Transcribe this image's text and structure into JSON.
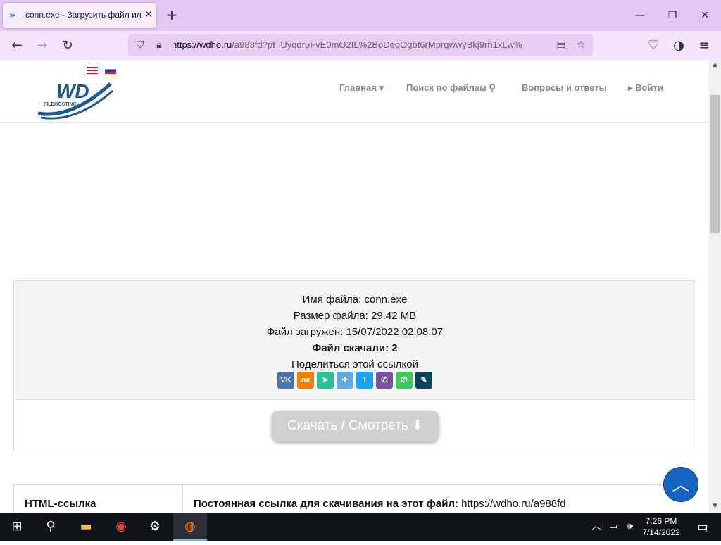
{
  "browser": {
    "tab_title": "conn.exe - Загрузить файл или",
    "url_host": "https://wdho.ru",
    "url_rest": "/a988fd?pt=Uyqdr5FvE0mO2IL%2BoDeqOgbt6rMprgwwyBkj9rh1xLw%"
  },
  "site": {
    "logo_text": "WD",
    "logo_sub": "FILEHOSTING",
    "menu": [
      {
        "label": "Главная"
      },
      {
        "label": "Поиск по файлам"
      },
      {
        "label": "Вопросы и ответы"
      },
      {
        "label": "Войти"
      }
    ]
  },
  "file": {
    "name_line": "Имя файла: conn.exe",
    "size_line": "Размер файла: 29.42 MB",
    "uploaded_line": "Файл загружен: 15/07/2022 02:08:07",
    "downloads_line": "Файл скачали: 2",
    "share_line": "Поделиться этой ссылкой",
    "download_button": "Скачать / Смотреть"
  },
  "share": [
    {
      "name": "vk",
      "glyph": "VK",
      "color": "#4a76a8"
    },
    {
      "name": "ok",
      "glyph": "ок",
      "color": "#ee8208"
    },
    {
      "name": "mail",
      "glyph": "➤",
      "color": "#2cbf9a"
    },
    {
      "name": "telegram",
      "glyph": "✈",
      "color": "#64a9dc"
    },
    {
      "name": "twitter",
      "glyph": "t",
      "color": "#1da1f2"
    },
    {
      "name": "viber",
      "glyph": "✆",
      "color": "#7b519d"
    },
    {
      "name": "whatsapp",
      "glyph": "✆",
      "color": "#42c85c"
    },
    {
      "name": "livejournal",
      "glyph": "✎",
      "color": "#0d425a"
    }
  ],
  "links": {
    "label": "HTML-ссылка",
    "value_bold": "Постоянная ссылка для скачивания на этот файл:",
    "value_url": "https://wdho.ru/a988fd"
  },
  "taskbar": {
    "time": "7:26 PM",
    "date": "7/14/2022",
    "notifications": "1"
  }
}
